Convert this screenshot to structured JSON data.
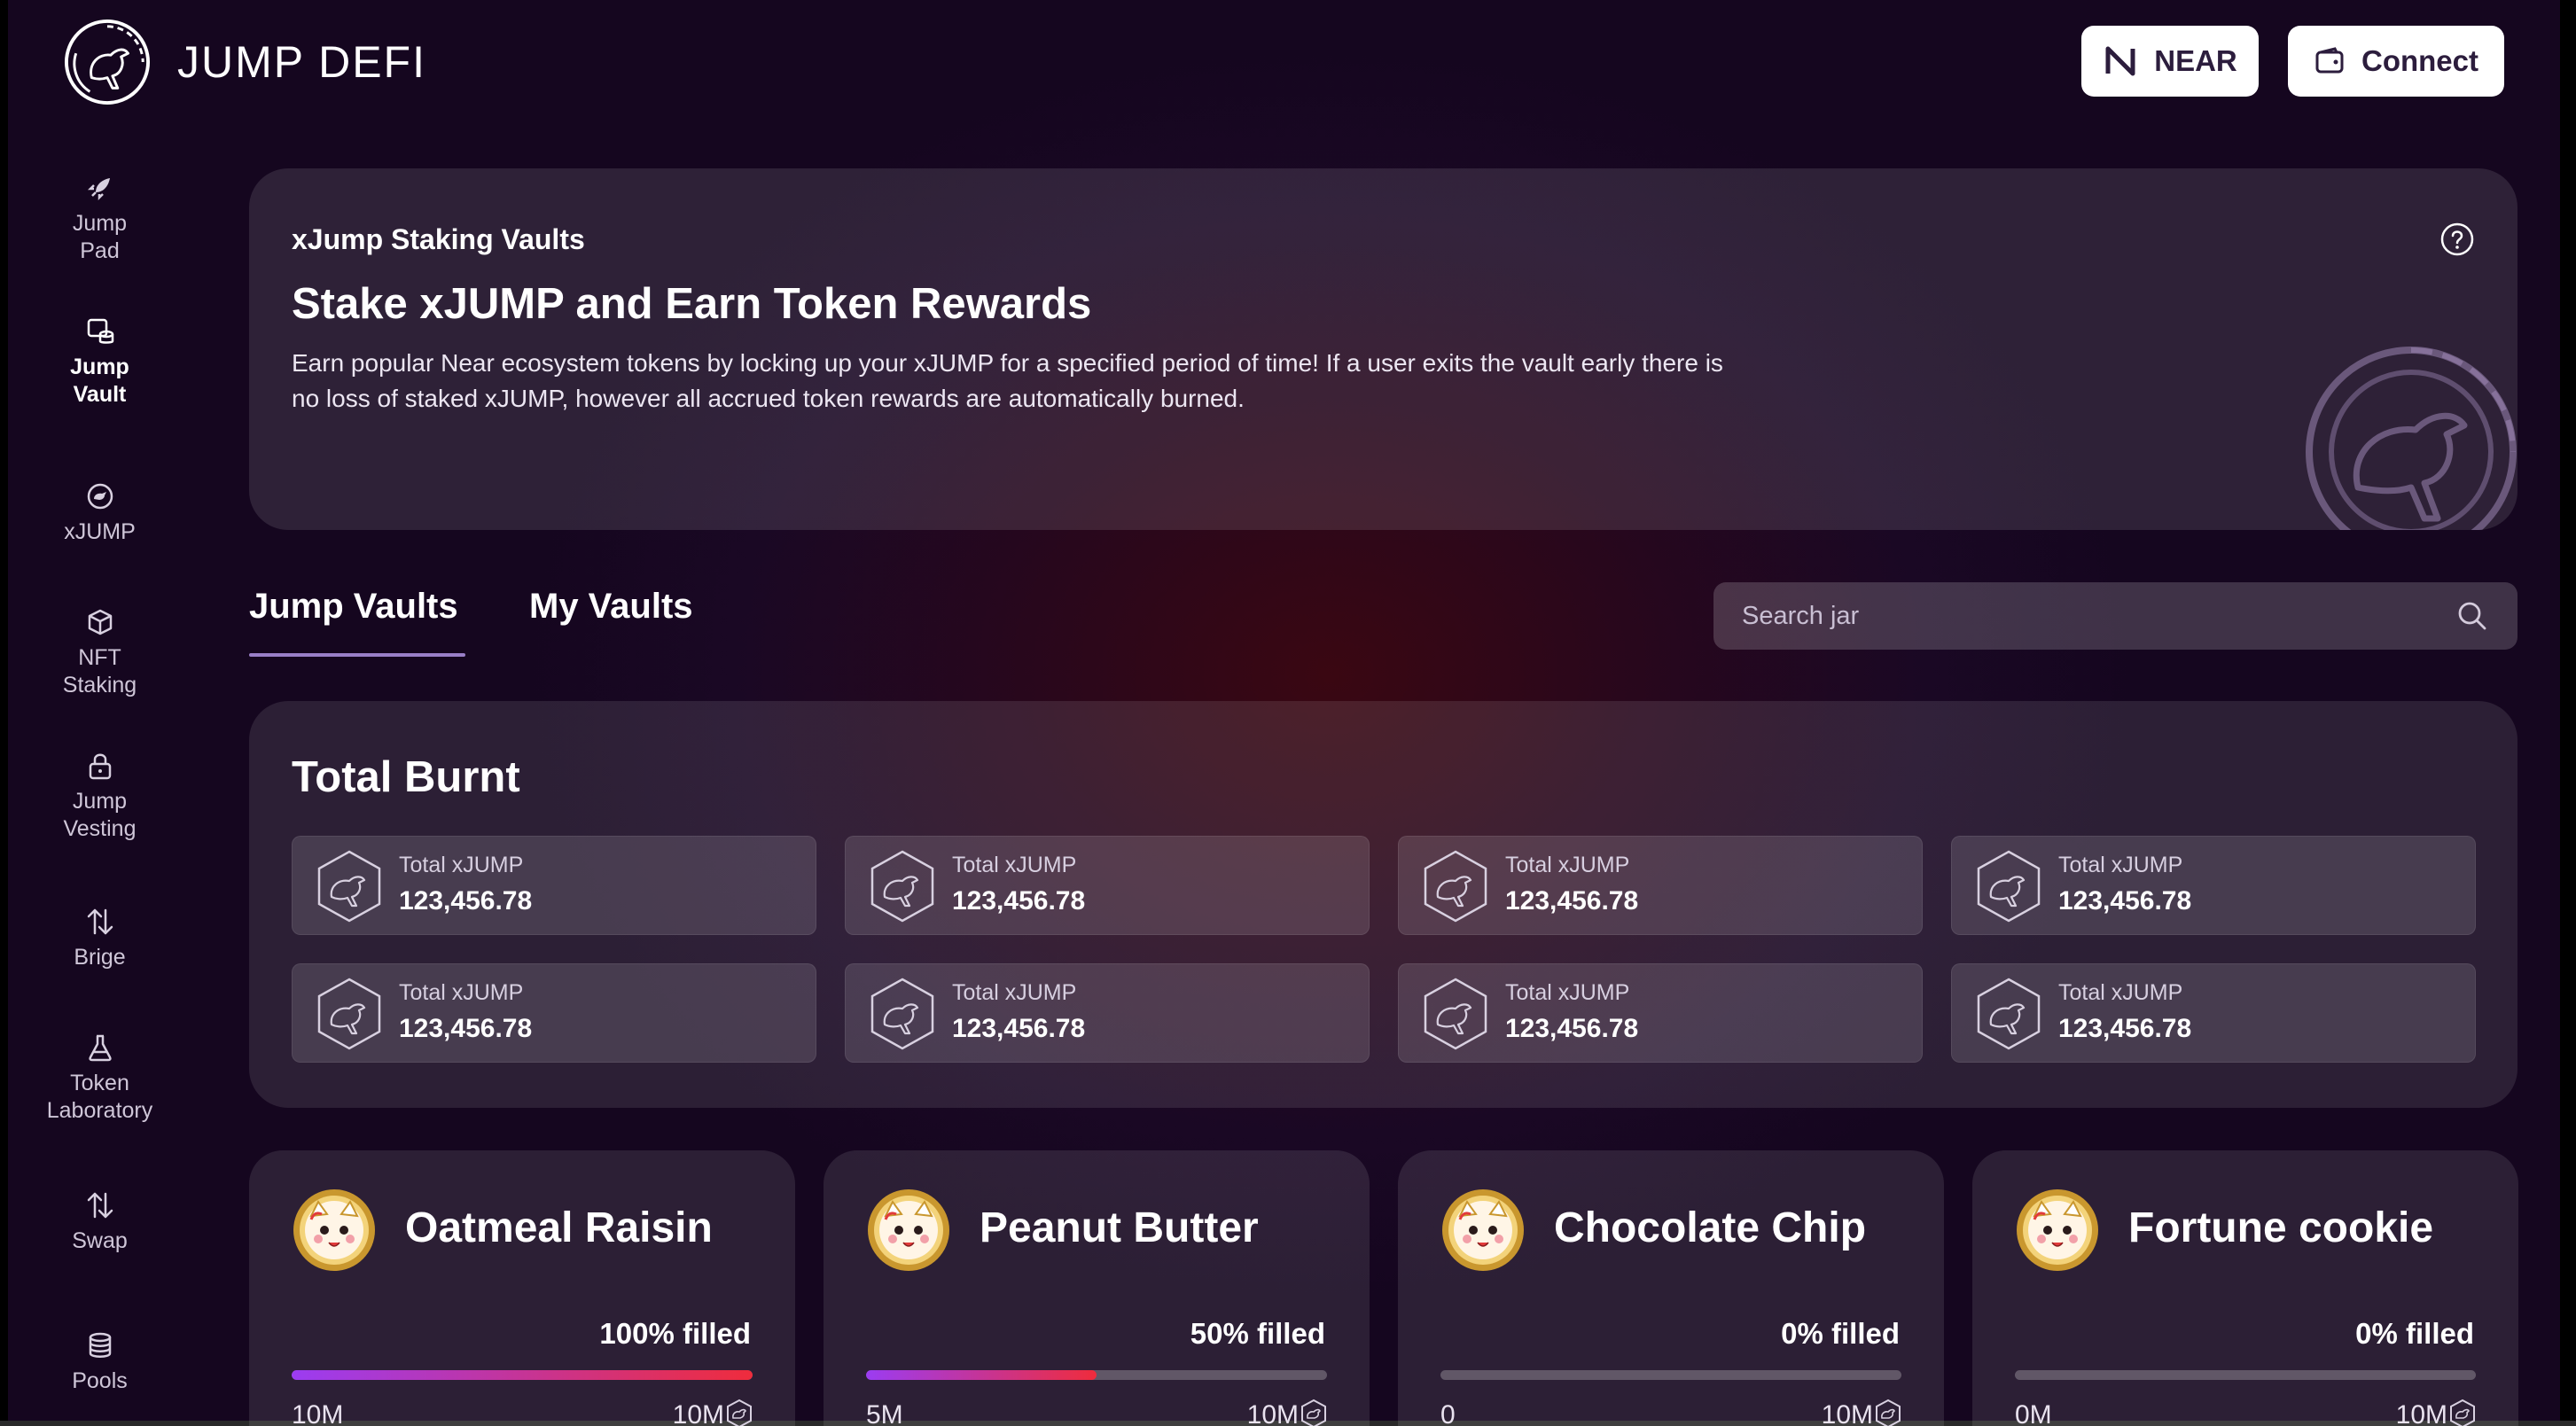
{
  "brand": {
    "name": "JUMP DEFI"
  },
  "header": {
    "network_label": "NEAR",
    "connect_label": "Connect"
  },
  "sidebar": {
    "items": [
      {
        "label": "Jump Pad",
        "icon": "rocket-icon",
        "active": false
      },
      {
        "label": "Jump Vault",
        "icon": "vault-icon",
        "active": true
      },
      {
        "label": "xJUMP",
        "icon": "xjump-coin-icon",
        "active": false
      },
      {
        "label": "NFT Staking",
        "icon": "cube-icon",
        "active": false
      },
      {
        "label": "Jump Vesting",
        "icon": "lock-icon",
        "active": false
      },
      {
        "label": "Brige",
        "icon": "bridge-arrows-icon",
        "active": false
      },
      {
        "label": "Token Laboratory",
        "icon": "flask-icon",
        "active": false
      },
      {
        "label": "Swap",
        "icon": "swap-arrows-icon",
        "active": false
      },
      {
        "label": "Pools",
        "icon": "database-icon",
        "active": false
      }
    ]
  },
  "hero": {
    "eyebrow": "xJump Staking Vaults",
    "title": "Stake xJUMP and Earn Token Rewards",
    "description": "Earn popular Near ecosystem tokens by locking up your xJUMP for a specified period of time! If a user exits the vault early there is no loss of staked xJUMP, however all accrued token rewards are automatically burned."
  },
  "tabs": {
    "jump_vaults": "Jump Vaults",
    "my_vaults": "My Vaults",
    "active": "Jump Vaults"
  },
  "search": {
    "placeholder": "Search jar",
    "value": ""
  },
  "total_burnt": {
    "title": "Total Burnt",
    "stats": [
      {
        "label": "Total xJUMP",
        "value": "123,456.78"
      },
      {
        "label": "Total xJUMP",
        "value": "123,456.78"
      },
      {
        "label": "Total xJUMP",
        "value": "123,456.78"
      },
      {
        "label": "Total xJUMP",
        "value": "123,456.78"
      },
      {
        "label": "Total xJUMP",
        "value": "123,456.78"
      },
      {
        "label": "Total xJUMP",
        "value": "123,456.78"
      },
      {
        "label": "Total xJUMP",
        "value": "123,456.78"
      },
      {
        "label": "Total xJUMP",
        "value": "123,456.78"
      }
    ]
  },
  "vaults": [
    {
      "name": "Oatmeal Raisin",
      "filled_label": "100% filled",
      "fill_fraction": 1.0,
      "min": "10M",
      "max": "10M"
    },
    {
      "name": "Peanut Butter",
      "filled_label": "50% filled",
      "fill_fraction": 0.5,
      "min": "5M",
      "max": "10M"
    },
    {
      "name": "Chocolate Chip",
      "filled_label": "0% filled",
      "fill_fraction": 0.0,
      "min": "0",
      "max": "10M"
    },
    {
      "name": "Fortune cookie",
      "filled_label": "0% filled",
      "fill_fraction": 0.0,
      "min": "0M",
      "max": "10M"
    }
  ],
  "colors": {
    "accent_start": "#9b3cf2",
    "accent_end": "#ef2c3c",
    "button_bg": "#ffffff",
    "button_text": "#2c1d3d"
  }
}
